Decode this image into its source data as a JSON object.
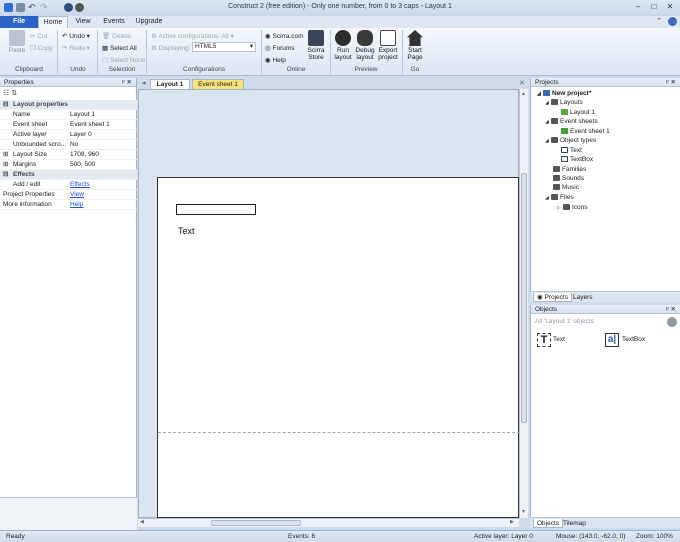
{
  "titlebar": {
    "title": "Construct 2  (free edition) - Only one number, from 0 to 3 caps - Layout 1"
  },
  "tabs": [
    "File",
    "Home",
    "View",
    "Events",
    "Upgrade"
  ],
  "ribbon": {
    "clipboard": {
      "paste": "Paste",
      "cut": "Cut",
      "copy": "Copy",
      "label": "Clipboard"
    },
    "undo": {
      "undo": "Undo",
      "redo": "Redo",
      "label": "Undo"
    },
    "selection": {
      "delete": "Delete",
      "select_all": "Select All",
      "select_none": "Select None",
      "label": "Selection"
    },
    "configurations": {
      "active": "Active configurations: All",
      "displaying": "Displaying:",
      "displaying_value": "HTML5",
      "label": "Configurations"
    },
    "online": {
      "scirra": "Scirra.com",
      "forums": "Forums",
      "help": "Help",
      "store": "Scirra Store",
      "label": "Online"
    },
    "preview": {
      "run": "Run layout",
      "debug": "Debug layout",
      "export": "Export project",
      "label": "Preview"
    },
    "go": {
      "start": "Start Page",
      "label": "Go"
    }
  },
  "properties": {
    "title": "Properties",
    "section_layout": "Layout properties",
    "rows": [
      {
        "name": "Name",
        "value": "Layout 1"
      },
      {
        "name": "Event sheet",
        "value": "Event sheet 1"
      },
      {
        "name": "Active layer",
        "value": "Layer 0"
      },
      {
        "name": "Unbounded scro...",
        "value": "No"
      },
      {
        "name": "Layout Size",
        "value": "1708, 960"
      },
      {
        "name": "Margins",
        "value": "500, 500"
      }
    ],
    "section_effects": "Effects",
    "effects_row": {
      "name": "Add / edit",
      "value": "Effects"
    },
    "project_props": {
      "name": "Project Properties",
      "value": "View"
    },
    "more_info": {
      "name": "More information",
      "value": "Help"
    }
  },
  "doc_tabs": [
    "Layout 1",
    "Event sheet 1"
  ],
  "layout": {
    "text_object": "Text"
  },
  "projects": {
    "title": "Projects",
    "root": "New project*",
    "layouts": "Layouts",
    "layout1": "Layout 1",
    "event_sheets": "Event sheets",
    "event_sheet1": "Event sheet 1",
    "object_types": "Object types",
    "obj_text": "Text",
    "obj_textbox": "TextBox",
    "families": "Families",
    "sounds": "Sounds",
    "music": "Music",
    "files": "Files",
    "icons": "Icons",
    "tabs": [
      "Projects",
      "Layers"
    ]
  },
  "objects": {
    "title": "Objects",
    "filter": "All 'Layout 1' objects",
    "items": [
      "Text",
      "TextBox"
    ],
    "tabs": [
      "Objects",
      "Tilemap"
    ]
  },
  "status": {
    "ready": "Ready",
    "events": "Events: 6",
    "active_layer": "Active layer: Layer 0",
    "mouse": "Mouse: (143.0, -62.0, 0)",
    "zoom": "Zoom: 100%"
  }
}
